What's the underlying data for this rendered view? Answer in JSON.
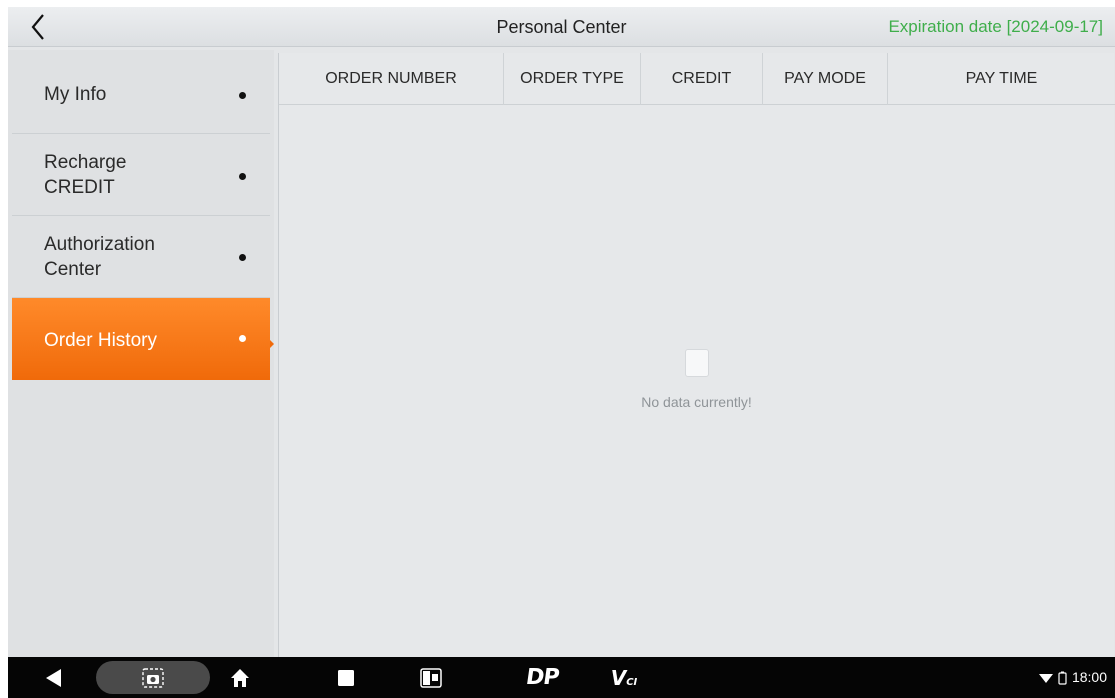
{
  "header": {
    "title": "Personal Center",
    "expiration": "Expiration date [2024-09-17]"
  },
  "sidebar": {
    "items": [
      {
        "label": "My Info",
        "active": false
      },
      {
        "label": "Recharge CREDIT",
        "active": false
      },
      {
        "label": "Authorization Center",
        "active": false
      },
      {
        "label": "Order History",
        "active": true
      }
    ]
  },
  "table": {
    "columns": [
      "ORDER NUMBER",
      "ORDER TYPE",
      "CREDIT",
      "PAY MODE",
      "PAY TIME"
    ],
    "rows": [],
    "empty_message": "No data currently!"
  },
  "navbar": {
    "icons": [
      "back-icon",
      "screenshot-icon",
      "home-icon",
      "recents-icon",
      "split-screen-icon",
      "dp-logo-icon",
      "vci-icon"
    ],
    "dp_label": "DP",
    "vci_label": "V",
    "vci_sub": "CI"
  },
  "status": {
    "time": "18:00"
  },
  "colors": {
    "accent": "#f57518",
    "expiration": "#3fae4b",
    "navbar": "#050505"
  }
}
